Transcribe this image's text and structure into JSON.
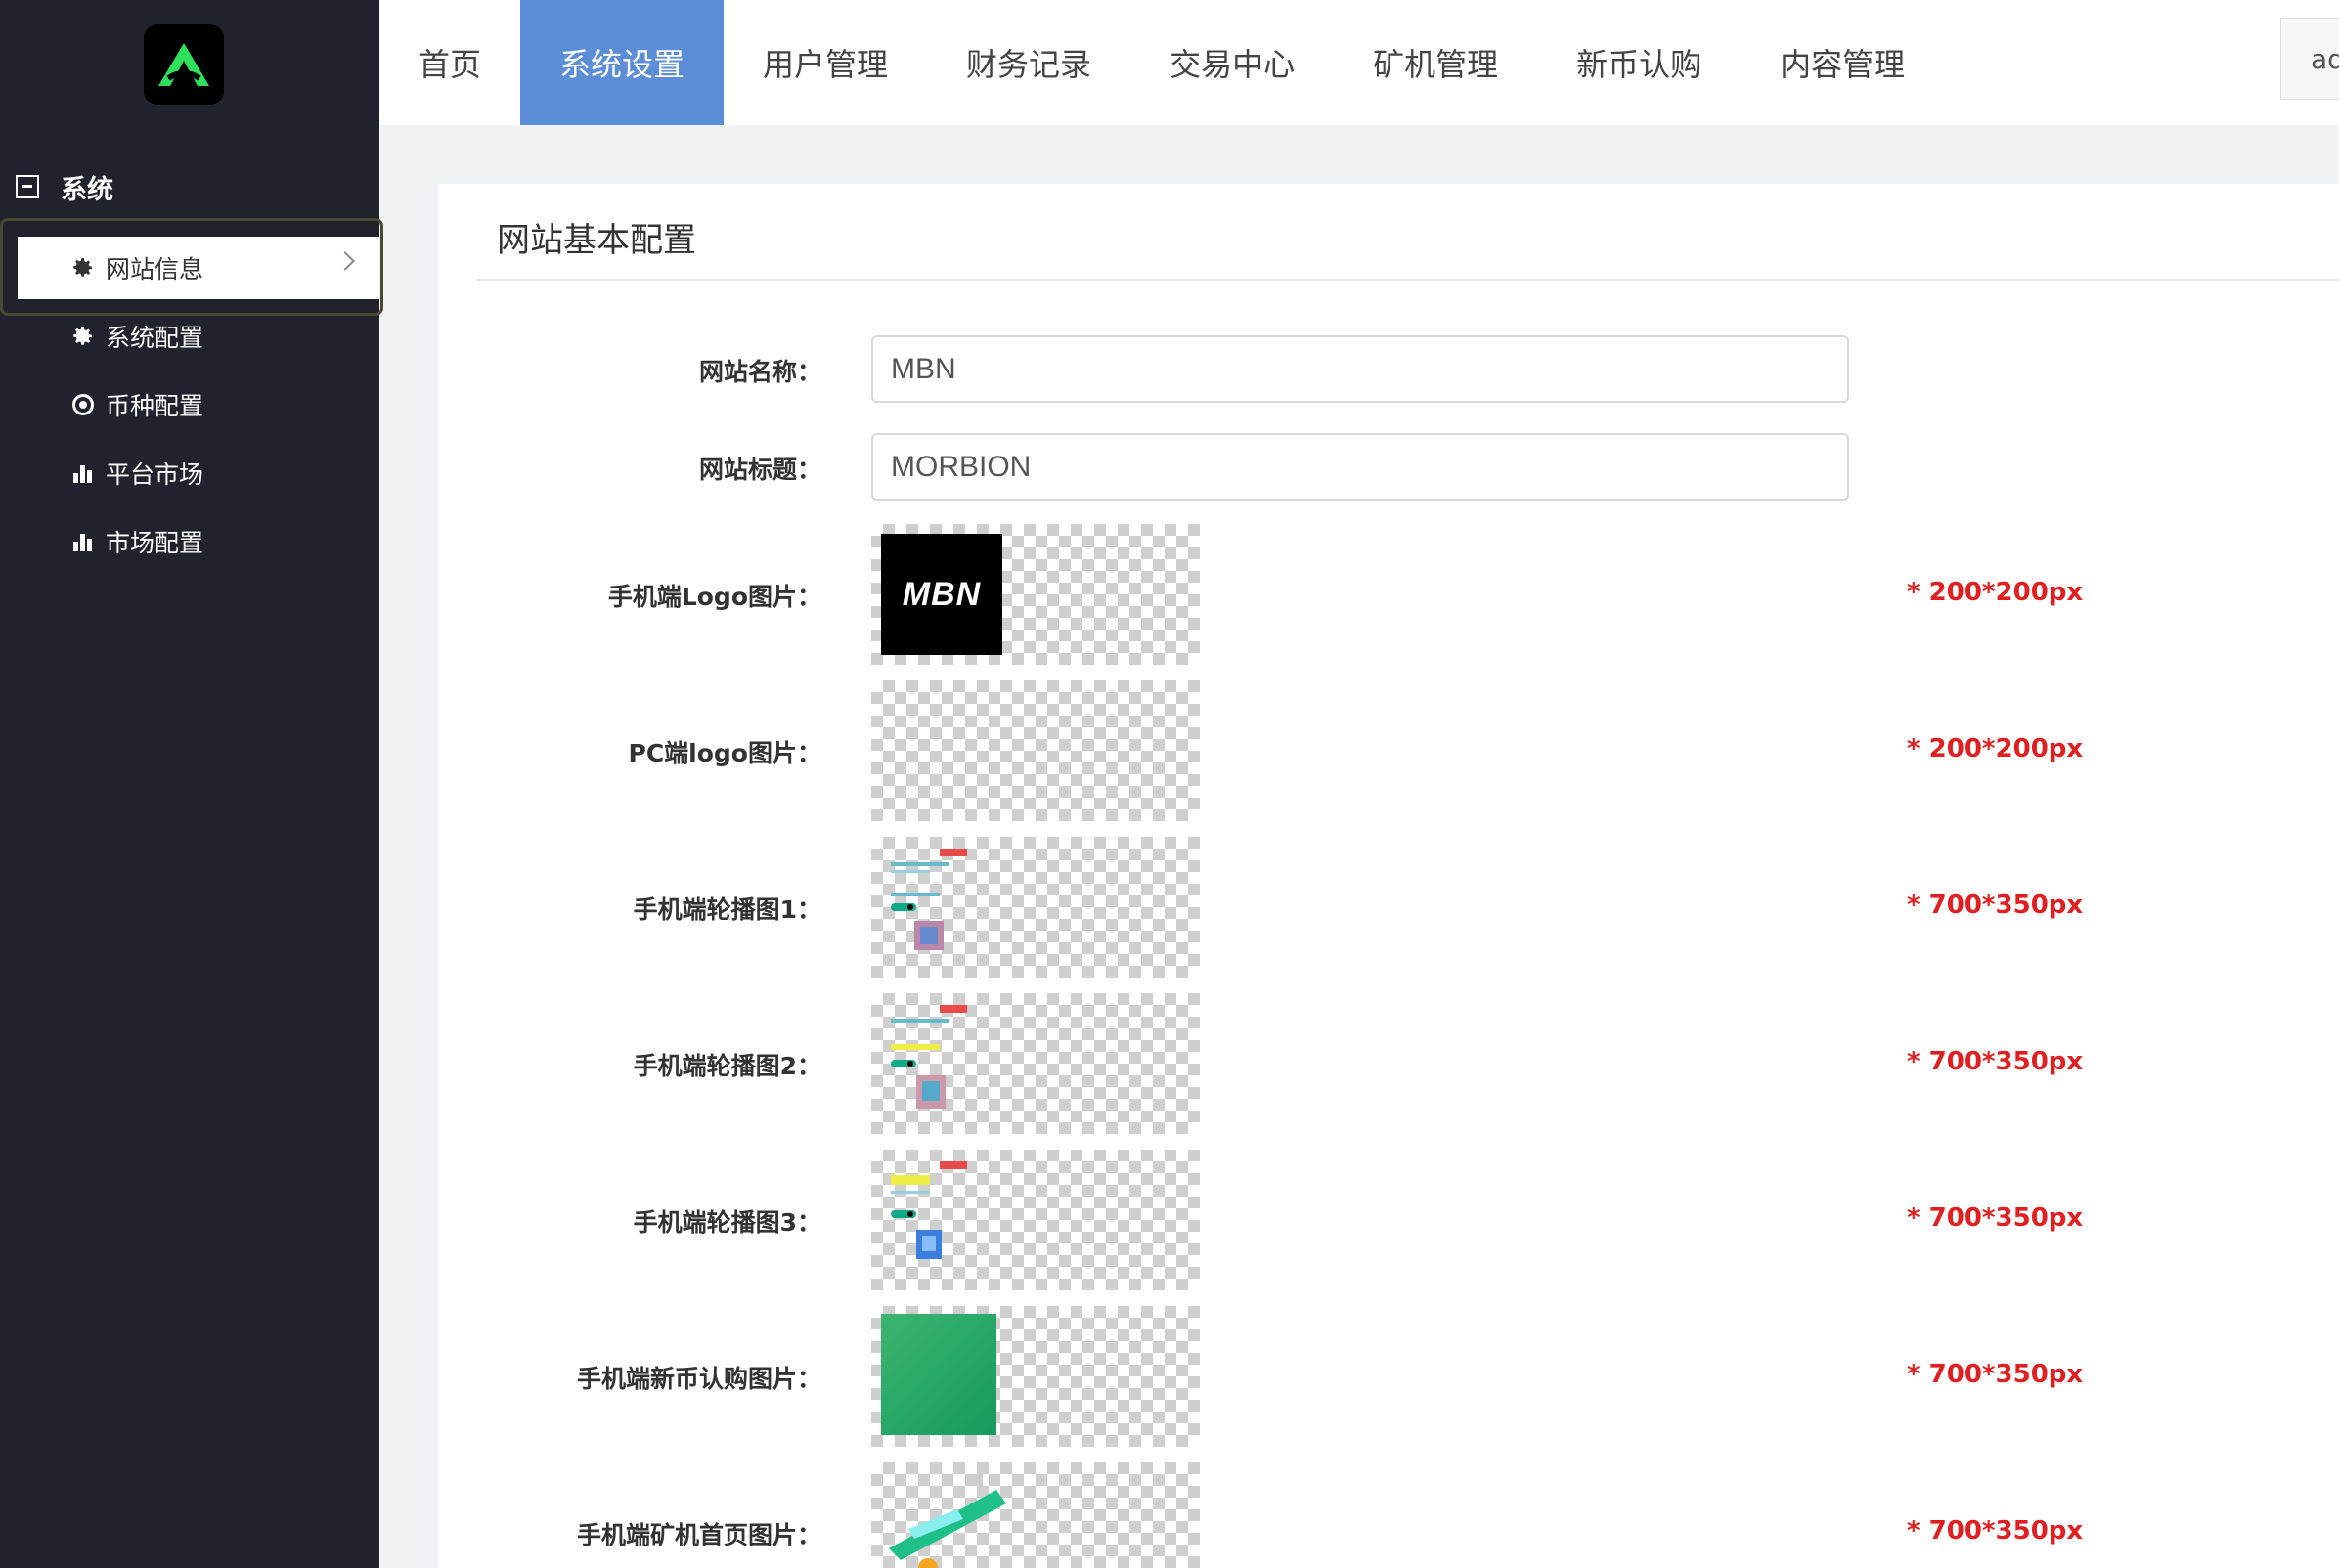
{
  "sidebar": {
    "group_title": "系统",
    "items": [
      {
        "label": "网站信息",
        "icon": "gear-icon"
      },
      {
        "label": "系统配置",
        "icon": "gear-icon"
      },
      {
        "label": "币种配置",
        "icon": "target-icon"
      },
      {
        "label": "平台市场",
        "icon": "bar-chart-icon"
      },
      {
        "label": "市场配置",
        "icon": "bar-chart-icon"
      }
    ]
  },
  "topnav": {
    "items": [
      {
        "label": "首页"
      },
      {
        "label": "系统设置"
      },
      {
        "label": "用户管理"
      },
      {
        "label": "财务记录"
      },
      {
        "label": "交易中心"
      },
      {
        "label": "矿机管理"
      },
      {
        "label": "新币认购"
      },
      {
        "label": "内容管理"
      }
    ],
    "user_label": "adr"
  },
  "panel": {
    "title": "网站基本配置",
    "site_name_label": "网站名称：",
    "site_name_value": "MBN",
    "site_title_label": "网站标题：",
    "site_title_value": "MORBION",
    "images": [
      {
        "label": "手机端Logo图片：",
        "hint": "* 200*200px",
        "logo_text": "MBN"
      },
      {
        "label": "PC端logo图片：",
        "hint": "* 200*200px"
      },
      {
        "label": "手机端轮播图1：",
        "hint": "* 700*350px"
      },
      {
        "label": "手机端轮播图2：",
        "hint": "* 700*350px"
      },
      {
        "label": "手机端轮播图3：",
        "hint": "* 700*350px"
      },
      {
        "label": "手机端新币认购图片：",
        "hint": "* 700*350px"
      },
      {
        "label": "手机端矿机首页图片：",
        "hint": "* 700*350px"
      }
    ]
  },
  "colors": {
    "sidebar_bg": "#22222e",
    "nav_active": "#5b8ed6",
    "hint_red": "#e02020",
    "brand_green": "#2ee05a"
  }
}
